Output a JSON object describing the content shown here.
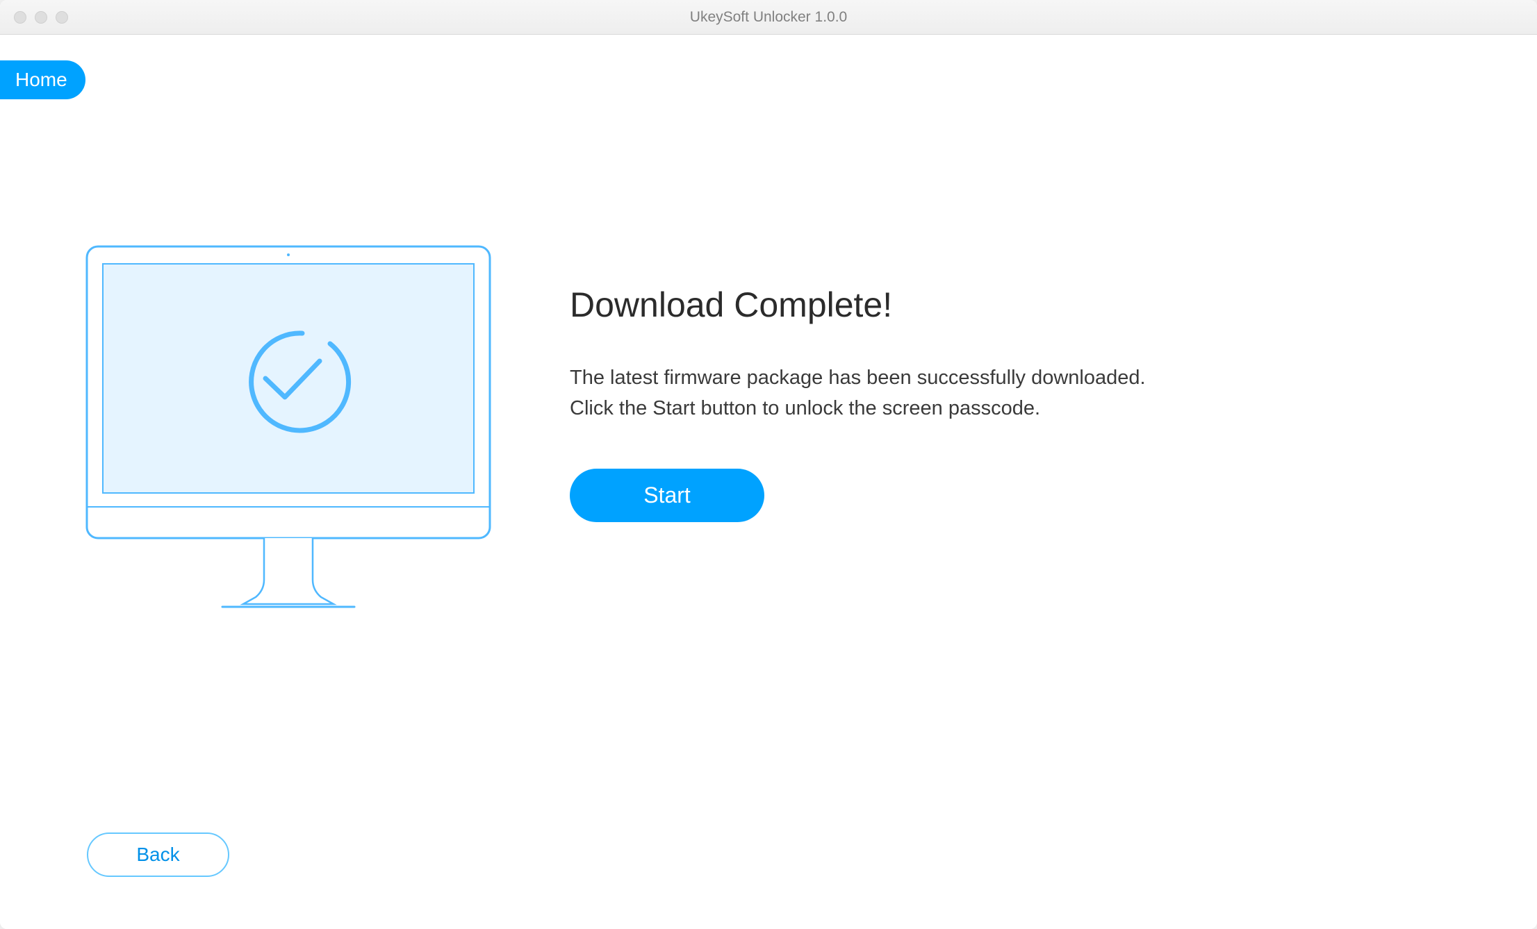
{
  "window": {
    "title": "UkeySoft Unlocker 1.0.0"
  },
  "nav": {
    "home_label": "Home"
  },
  "main": {
    "heading": "Download Complete!",
    "description_line1": "The latest firmware package has been successfully downloaded.",
    "description_line2": "Click the Start button to unlock the screen passcode.",
    "start_label": "Start"
  },
  "footer": {
    "back_label": "Back"
  },
  "colors": {
    "accent": "#00a2ff",
    "text_dark": "#2b2b2b",
    "illustration_stroke": "#4fb8ff",
    "illustration_fill": "#e5f4ff"
  }
}
